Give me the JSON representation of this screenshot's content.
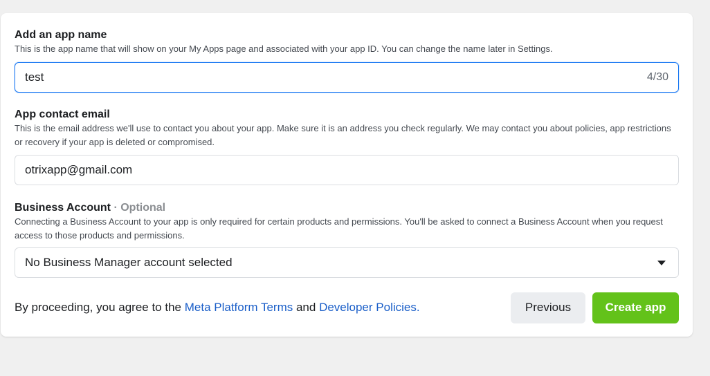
{
  "app_name": {
    "label": "Add an app name",
    "description": "This is the app name that will show on your My Apps page and associated with your app ID. You can change the name later in Settings.",
    "value": "test",
    "counter": "4/30"
  },
  "contact_email": {
    "label": "App contact email",
    "description": "This is the email address we'll use to contact you about your app. Make sure it is an address you check regularly. We may contact you about policies, app restrictions or recovery if your app is deleted or compromised.",
    "value": "otrixapp@gmail.com"
  },
  "business_account": {
    "label": "Business Account",
    "optional": "· Optional",
    "description": "Connecting a Business Account to your app is only required for certain products and permissions. You'll be asked to connect a Business Account when you request access to those products and permissions.",
    "selected": "No Business Manager account selected",
    "icon": "caret-down-icon"
  },
  "footer": {
    "terms_prefix": "By proceeding, you agree to the ",
    "platform_terms_link": "Meta Platform Terms",
    "and_text": " and ",
    "developer_policies_link": "Developer Policies.",
    "previous_label": "Previous",
    "create_label": "Create app"
  },
  "colors": {
    "primary_button": "#63c21a",
    "link": "#1a5ec8",
    "focus_border": "#1877f2",
    "page_background": "#f0f0f0"
  }
}
